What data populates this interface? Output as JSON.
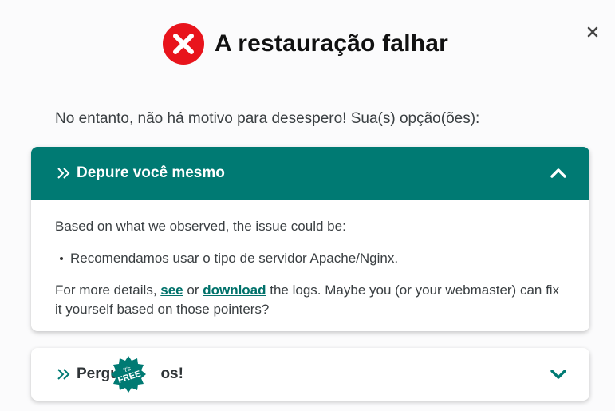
{
  "dialog": {
    "title": "A restauração falhar",
    "intro": "No entanto, não há motivo para desespero! Sua(s) opção(ões):"
  },
  "panel1": {
    "label": "Depure você mesmo",
    "observed": "Based on what we observed, the issue could be:",
    "bullet": "Recomendamos usar o tipo de servidor Apache/Nginx.",
    "more_prefix": "For more details, ",
    "see_link": "see",
    "or": " or ",
    "download_link": "download",
    "more_suffix": " the logs. Maybe you (or your webmaster) can fix it yourself based on those pointers?"
  },
  "panel2": {
    "label_start": "Pergun",
    "label_end": "os!"
  },
  "badge": {
    "line1": "It's",
    "line2": "FREE"
  },
  "colors": {
    "accent": "#007a73",
    "error": "#e8141c"
  },
  "icons": [
    "close-icon",
    "error-icon",
    "double-chevron-right-icon",
    "chevron-up-icon",
    "chevron-down-icon",
    "free-badge-icon"
  ]
}
